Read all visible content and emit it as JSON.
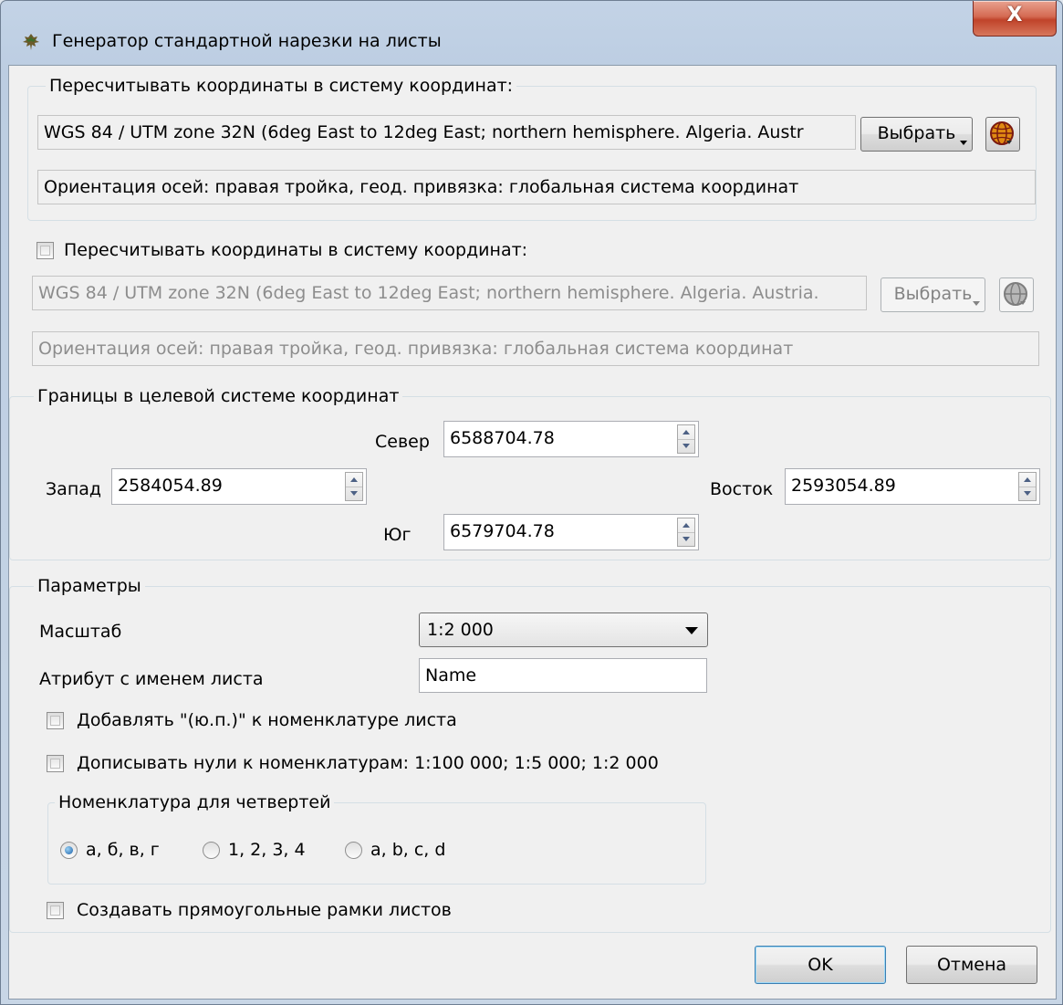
{
  "window": {
    "title": "Генератор стандартной нарезки на листы",
    "close_label": "X"
  },
  "crs1": {
    "group_title": "Пересчитывать координаты в систему координат:",
    "value": "WGS 84 / UTM zone 32N (6deg East to 12deg East; northern hemisphere. Algeria. Austr",
    "choose_label": "Выбрать",
    "orientation": "Ориентация осей: правая тройка, геод. привязка: глобальная система координат"
  },
  "crs2": {
    "checkbox_label": "Пересчитывать координаты в систему координат:",
    "checked": false,
    "value": "WGS 84 / UTM zone 32N (6deg East to 12deg East; northern hemisphere. Algeria. Austria.",
    "choose_label": "Выбрать",
    "orientation": "Ориентация осей: правая тройка, геод. привязка: глобальная система координат"
  },
  "bounds": {
    "group_title": "Границы в целевой системе координат",
    "north_label": "Север",
    "north_value": "6588704.78",
    "west_label": "Запад",
    "west_value": "2584054.89",
    "east_label": "Восток",
    "east_value": "2593054.89",
    "south_label": "Юг",
    "south_value": "6579704.78"
  },
  "params": {
    "group_title": "Параметры",
    "scale_label": "Масштаб",
    "scale_value": "1:2 000",
    "attr_label": "Атрибут с именем листа",
    "attr_value": "Name",
    "add_suffix_label": "Добавлять \"(ю.п.)\" к номенклатуре листа",
    "add_zeros_label": "Дописывать нули к номенклатурам: 1:100 000; 1:5 000; 1:2 000",
    "quarters": {
      "group_title": "Номенклатура для четвертей",
      "options": [
        "а, б, в, г",
        "1, 2, 3, 4",
        "a, b, c, d"
      ],
      "selected_index": 0
    },
    "rect_frames_label": "Создавать прямоугольные рамки листов"
  },
  "buttons": {
    "ok_label": "OK",
    "cancel_label": "Отмена"
  },
  "colors": {
    "title_bar": "#bccde2",
    "client_bg": "#f0f0f0",
    "close_button": "#c0432a",
    "disabled_text": "#8d8d8d"
  },
  "icons": {
    "title": "tree-icon",
    "crs1_globe": "globe-icon",
    "crs2_globe": "globe-icon"
  }
}
